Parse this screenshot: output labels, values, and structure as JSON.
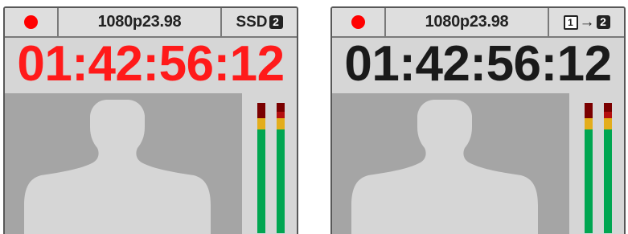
{
  "panels": [
    {
      "record_color": "#ff0000",
      "video_format": "1080p23.98",
      "media_label": "SSD",
      "media_slot": "2",
      "timecode": "01:42:56:12",
      "timecode_color": "#ff1a1a"
    },
    {
      "record_color": "#ff0000",
      "video_format": "1080p23.98",
      "media_from": "1",
      "media_arrow": "→",
      "media_to": "2",
      "timecode": "01:42:56:12",
      "timecode_color": "#1a1a1a"
    }
  ],
  "colors": {
    "panel_bg": "#d6d6d6",
    "video_bg": "#a5a5a5",
    "silhouette": "#d6d6d6",
    "meter_green": "#00a651",
    "meter_amber": "#e3ad1c",
    "meter_red": "#7a0000"
  }
}
